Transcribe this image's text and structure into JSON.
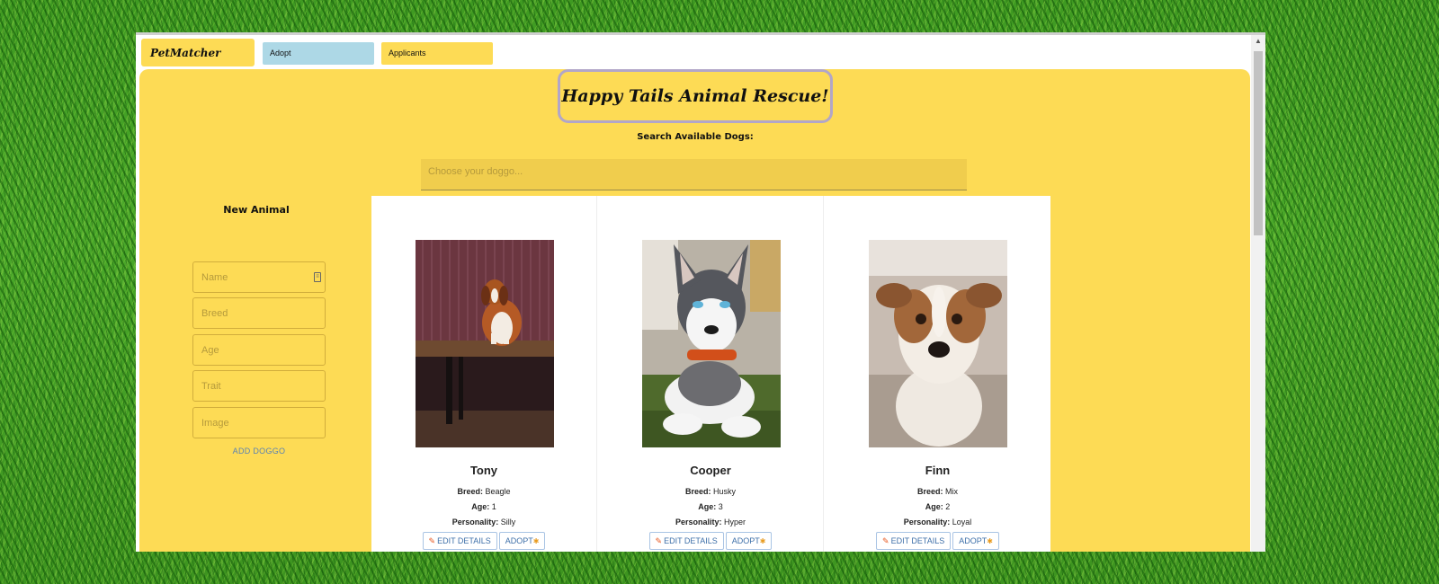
{
  "nav": {
    "brand": "PetMatcher",
    "tabs": [
      "Adopt",
      "Applicants"
    ]
  },
  "banner": {
    "title": "Happy Tails Animal Rescue!"
  },
  "search": {
    "label": "Search Available Dogs:",
    "placeholder": "Choose your doggo..."
  },
  "new_animal": {
    "title": "New Animal",
    "fields": [
      "Name",
      "Breed",
      "Age",
      "Trait",
      "Image"
    ],
    "submit": "ADD DOGGO"
  },
  "labels": {
    "breed": "Breed:",
    "age": "Age:",
    "personality": "Personality:"
  },
  "buttons": {
    "edit": "EDIT DETAILS",
    "adopt": "ADOPT"
  },
  "dogs": [
    {
      "name": "Tony",
      "breed": "Beagle",
      "age": "1",
      "personality": "Silly"
    },
    {
      "name": "Cooper",
      "breed": "Husky",
      "age": "3",
      "personality": "Hyper"
    },
    {
      "name": "Finn",
      "breed": "Mix",
      "age": "2",
      "personality": "Loyal"
    }
  ],
  "colors": {
    "main_bg": "#fddb55",
    "adopt_tab": "#add8e6",
    "button_text": "#3d6fa8",
    "banner_border": "#b2a6c8"
  },
  "icons": [
    "pencil-icon",
    "paw-icon",
    "id-card-icon",
    "scroll-up-arrow-icon"
  ]
}
